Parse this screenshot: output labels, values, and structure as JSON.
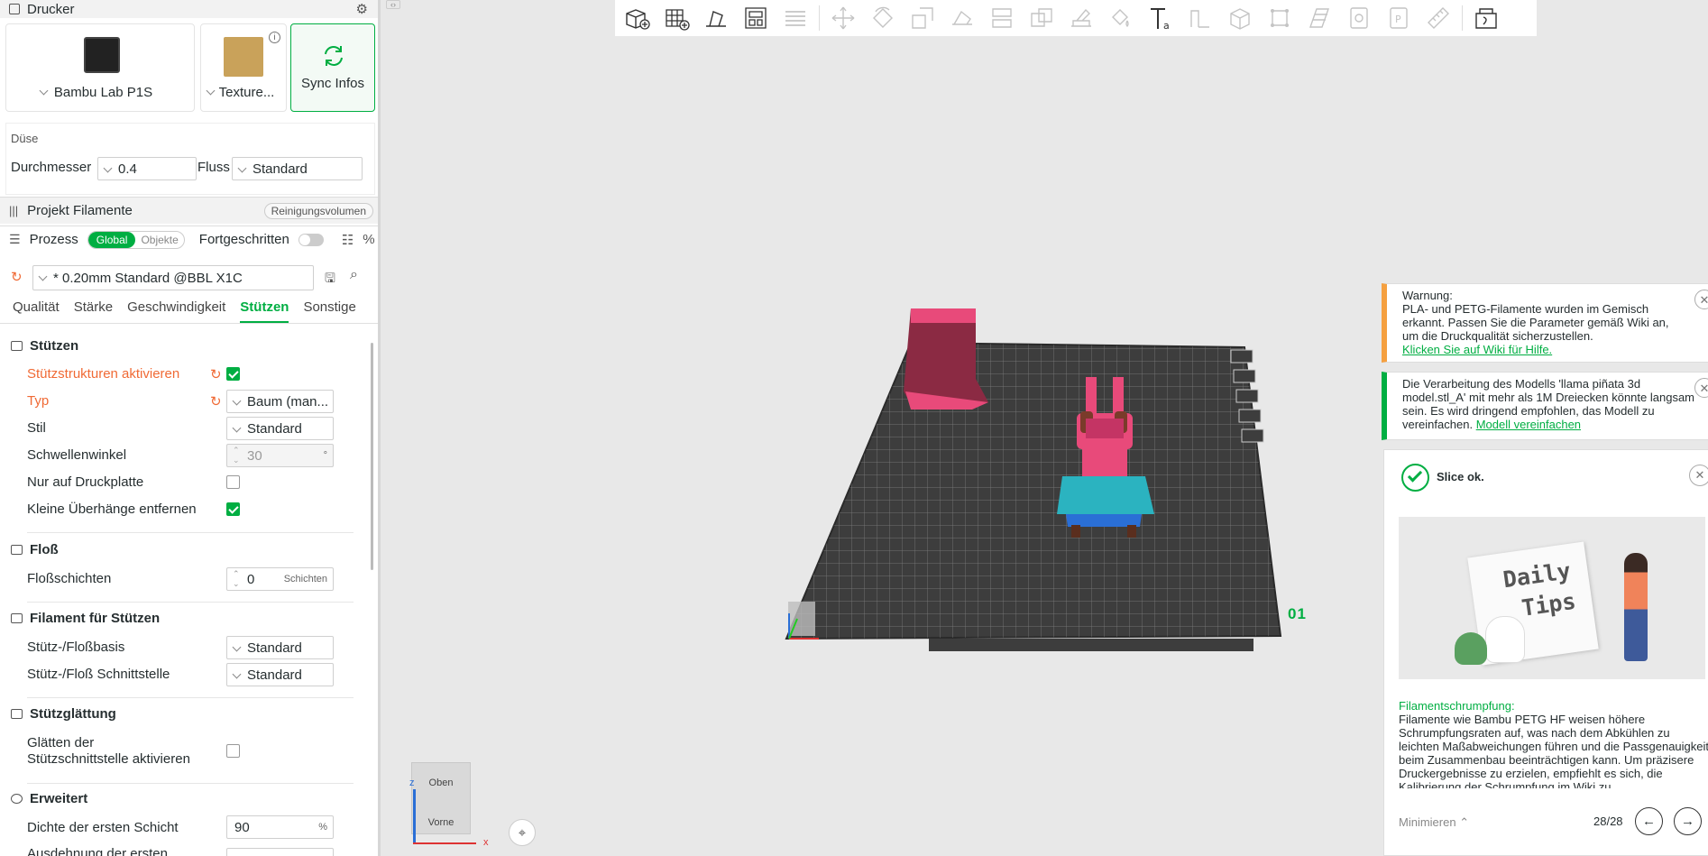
{
  "printer": {
    "header": "Drucker",
    "name": "Bambu Lab P1S",
    "plate": "Texture...",
    "sync": "Sync Infos"
  },
  "nozzle": {
    "section": "Düse",
    "diameter_label": "Durchmesser",
    "diameter_value": "0.4",
    "flow_label": "Fluss",
    "flow_value": "Standard"
  },
  "filament": {
    "title": "Projekt Filamente",
    "purge_button": "Reinigungsvolumen"
  },
  "process": {
    "title": "Prozess",
    "global": "Global",
    "objects": "Objekte",
    "advanced": "Fortgeschritten",
    "preset": "* 0.20mm Standard @BBL X1C"
  },
  "tabs": [
    "Qualität",
    "Stärke",
    "Geschwindigkeit",
    "Stützen",
    "Sonstige"
  ],
  "support": {
    "group": "Stützen",
    "enable_label": "Stützstrukturen aktivieren",
    "type_label": "Typ",
    "type_value": "Baum (man...",
    "style_label": "Stil",
    "style_value": "Standard",
    "threshold_label": "Schwellenwinkel",
    "threshold_value": "30",
    "threshold_unit": "°",
    "plate_only_label": "Nur auf Druckplatte",
    "remove_small_label": "Kleine Überhänge entfernen"
  },
  "raft": {
    "group": "Floß",
    "layers_label": "Floßschichten",
    "layers_value": "0",
    "layers_unit": "Schichten"
  },
  "support_filament": {
    "group": "Filament für Stützen",
    "base_label": "Stütz-/Floßbasis",
    "base_value": "Standard",
    "iface_label": "Stütz-/Floß Schnittstelle",
    "iface_value": "Standard"
  },
  "ironing": {
    "group": "Stützglättung",
    "label_line1": "Glätten der",
    "label_line2": "Stützschnittstelle aktivieren"
  },
  "advanced": {
    "group": "Erweitert",
    "density_label": "Dichte der ersten Schicht",
    "density_value": "90",
    "density_unit": "%",
    "expansion_label": "Ausdehnung der ersten"
  },
  "viewport": {
    "plate_number": "01",
    "cube_top": "Oben",
    "cube_front": "Vorne",
    "axis_x": "x",
    "axis_z": "z"
  },
  "warning": {
    "title": "Warnung:",
    "text": "PLA- und PETG-Filamente wurden im Gemisch erkannt. Passen Sie die Parameter gemäß Wiki an, um die Druckqualität sicherzustellen.",
    "link": "Klicken Sie auf Wiki für Hilfe."
  },
  "info": {
    "text": "Die Verarbeitung des Modells 'llama piñata 3d model.stl_A' mit mehr als 1M Dreiecken könnte langsam sein. Es wird dringend empfohlen, das Modell zu vereinfachen.",
    "link": "Modell vereinfachen"
  },
  "slice": {
    "status": "Slice ok.",
    "tip_img_line1": "Daily",
    "tip_img_line2": "Tips",
    "tip_title": "Filamentschrumpfung:",
    "tip_text": "Filamente wie Bambu PETG HF weisen höhere Schrumpfungsraten auf, was nach dem Abkühlen zu leichten Maßabweichungen führen und die Passgenauigkeit beim Zusammenbau beeinträchtigen kann. Um präzisere Druckergebnisse zu erzielen, empfiehlt es sich, die Kalibrierung der Schrumpfung im Wiki zu",
    "minimize": "Minimieren",
    "pager": "28/28"
  },
  "colors": {
    "accent": "#00ae42",
    "reset": "#f06a35",
    "warning_bar": "#f5a040",
    "pink": "#e84a7a",
    "teal": "#2bb3c0",
    "plate": "#3d3d3d"
  }
}
